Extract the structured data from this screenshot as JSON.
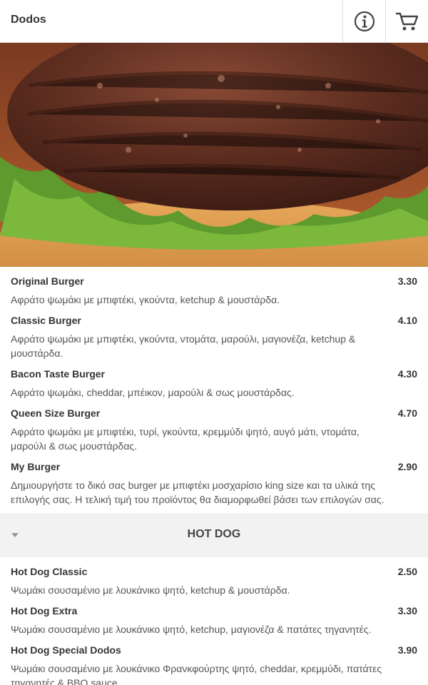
{
  "header": {
    "title": "Dodos",
    "info_icon": "info-icon",
    "cart_icon": "cart-icon"
  },
  "hero": {
    "image": "burger-patty-photo"
  },
  "section_burgers": {
    "items": [
      {
        "name": "Original Burger",
        "price": "3.30",
        "description": "Αφράτο ψωμάκι με μπιφτέκι, γκούντα, ketchup & μουστάρδα."
      },
      {
        "name": "Classic Burger",
        "price": "4.10",
        "description": "Αφράτο ψωμάκι με μπιφτέκι, γκούντα, ντομάτα, μαρούλι, μαγιονέζα, ketchup & μουστάρδα."
      },
      {
        "name": "Bacon Taste Burger",
        "price": "4.30",
        "description": "Αφράτο ψωμάκι, cheddar, μπέικον, μαρούλι & σως μουστάρδας."
      },
      {
        "name": "Queen Size Burger",
        "price": "4.70",
        "description": "Αφράτο ψωμάκι με μπιφτέκι, τυρί, γκούντα, κρεμμύδι ψητό, αυγό μάτι, ντομάτα, μαρούλι & σως μουστάρδας."
      },
      {
        "name": "My Burger",
        "price": "2.90",
        "description": "Δημιουργήστε το δικό σας burger με μπιφτέκι μοσχαρίσιο king size και τα υλικά της επιλογής σας. Η τελική τιμή του προϊόντος θα διαμορφωθεί βάσει των επιλογών σας."
      }
    ]
  },
  "category_hotdog": {
    "title": "HOT DOG",
    "caret_icon": "caret-down-icon"
  },
  "section_hotdogs": {
    "items": [
      {
        "name": "Hot Dog Classic",
        "price": "2.50",
        "description": "Ψωμάκι σουσαμένιο με λουκάνικο ψητό, ketchup & μουστάρδα."
      },
      {
        "name": "Hot Dog Extra",
        "price": "3.30",
        "description": "Ψωμάκι σουσαμένιο με λουκάνικο ψητό, ketchup, μαγιονέζα & πατάτες τηγανητές."
      },
      {
        "name": "Hot Dog Special Dodos",
        "price": "3.90",
        "description": "Ψωμάκι σουσαμένιο με λουκάνικο Φρανκφούρτης ψητό, cheddar, κρεμμύδι, πατάτες τηγανητές & BBQ sauce."
      }
    ]
  }
}
